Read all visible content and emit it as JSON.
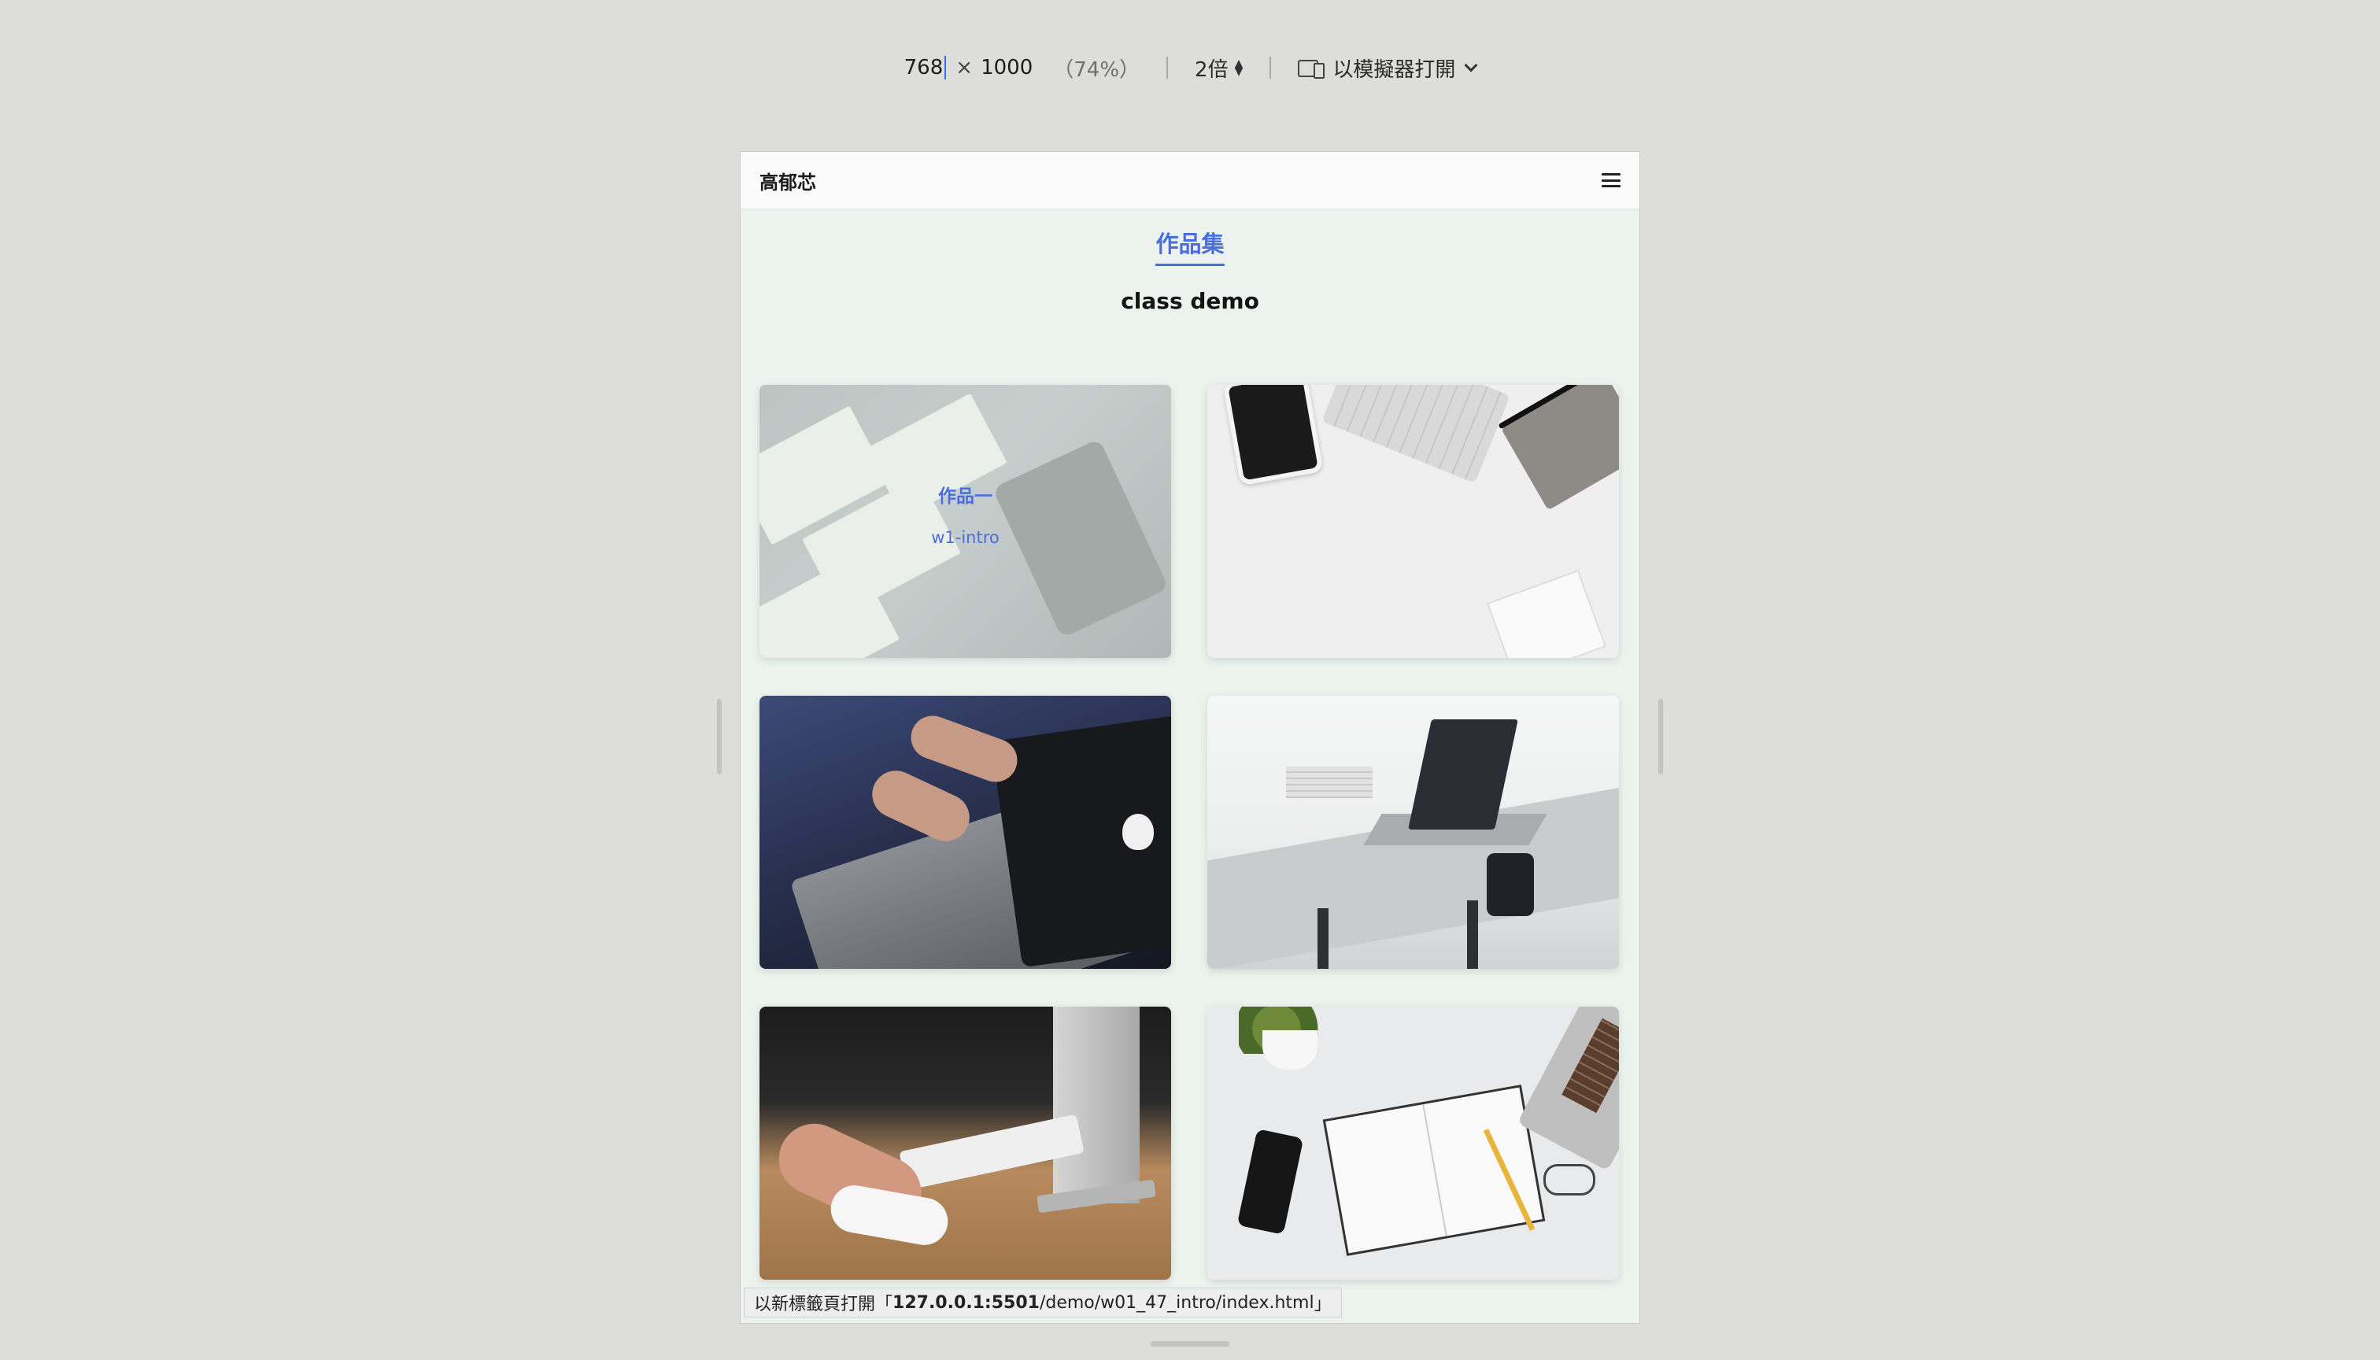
{
  "toolbar": {
    "width_value": "768",
    "times": "×",
    "height_value": "1000",
    "zoom_percent": "（74%）",
    "scale": "2倍",
    "emulator_label": "以模擬器打開"
  },
  "site": {
    "brand": "高郁芯",
    "section_title": "作品集",
    "subtitle": "class demo",
    "cards": [
      {
        "title": "作品一",
        "subtitle": "w1-intro",
        "hovered": true
      },
      {
        "title": "",
        "subtitle": "",
        "hovered": false
      },
      {
        "title": "",
        "subtitle": "",
        "hovered": false
      },
      {
        "title": "",
        "subtitle": "",
        "hovered": false
      },
      {
        "title": "",
        "subtitle": "",
        "hovered": false
      },
      {
        "title": "",
        "subtitle": "",
        "hovered": false
      }
    ]
  },
  "status_bar": {
    "prefix": "以新標籤頁打開「",
    "host": "127.0.0.1:5501",
    "path": "/demo/w01_47_intro/index.html",
    "suffix": "」"
  },
  "icons": {
    "menu": "hamburger-menu-icon",
    "device": "device-emulator-icon",
    "stepper": "up-down-stepper-icon",
    "dropdown": "chevron-down-icon"
  },
  "colors": {
    "accent": "#4a6ee0",
    "page_background": "#ecf3ef",
    "chrome_background": "#dddddb"
  }
}
